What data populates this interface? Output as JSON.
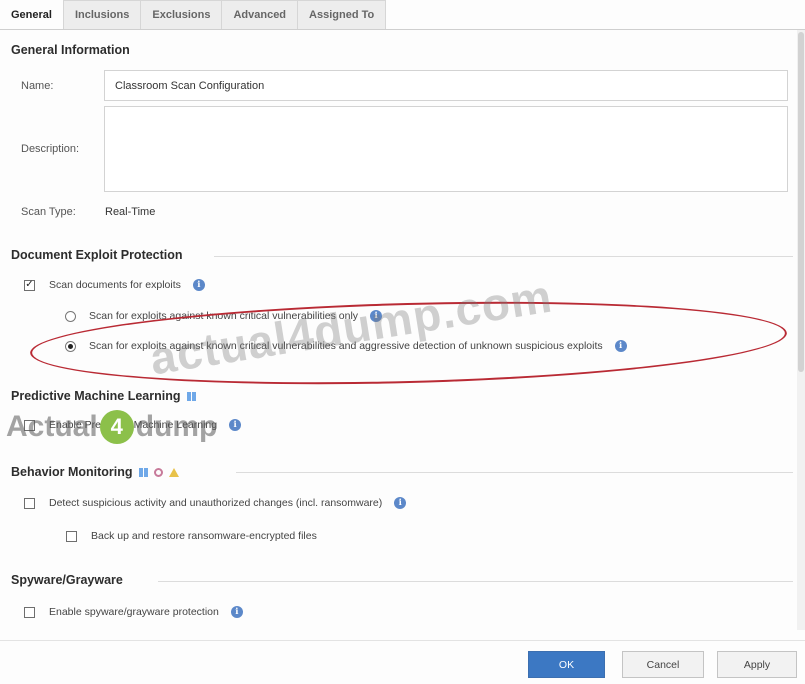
{
  "tabs": [
    {
      "label": "General",
      "active": true
    },
    {
      "label": "Inclusions",
      "active": false
    },
    {
      "label": "Exclusions",
      "active": false
    },
    {
      "label": "Advanced",
      "active": false
    },
    {
      "label": "Assigned To",
      "active": false
    }
  ],
  "general": {
    "title": "General Information",
    "name_label": "Name:",
    "name_value": "Classroom Scan Configuration",
    "description_label": "Description:",
    "description_value": "",
    "scan_type_label": "Scan Type:",
    "scan_type_value": "Real-Time"
  },
  "document_exploit": {
    "title": "Document Exploit Protection",
    "scan_documents_label": "Scan documents for exploits",
    "scan_documents_checked": true,
    "options": [
      {
        "label": "Scan for exploits against known critical vulnerabilities only",
        "selected": false
      },
      {
        "label": "Scan for exploits against known critical vulnerabilities and aggressive detection of unknown suspicious exploits",
        "selected": true
      }
    ]
  },
  "predictive_ml": {
    "title": "Predictive Machine Learning",
    "enable_label": "Enable Predictive Machine Learning",
    "enable_checked": false
  },
  "behavior": {
    "title": "Behavior Monitoring",
    "platform_icons": [
      "windows-icon",
      "mac-icon",
      "warning-icon"
    ],
    "detect_label": "Detect suspicious activity and unauthorized changes (incl. ransomware)",
    "detect_checked": false,
    "backup_label": "Back up and restore ransomware-encrypted files",
    "backup_checked": false
  },
  "spyware": {
    "title": "Spyware/Grayware",
    "enable_label": "Enable spyware/grayware protection",
    "enable_checked": false
  },
  "buttons": {
    "ok": "OK",
    "cancel": "Cancel",
    "apply": "Apply"
  },
  "watermark": {
    "text1": "actual4dump.com",
    "text2_a": "Actual",
    "text2_b": "4",
    "text2_c": "dump"
  },
  "colors": {
    "accent": "#3c78c3",
    "info_icon": "#5c88c9",
    "highlight": "#b92a34"
  }
}
